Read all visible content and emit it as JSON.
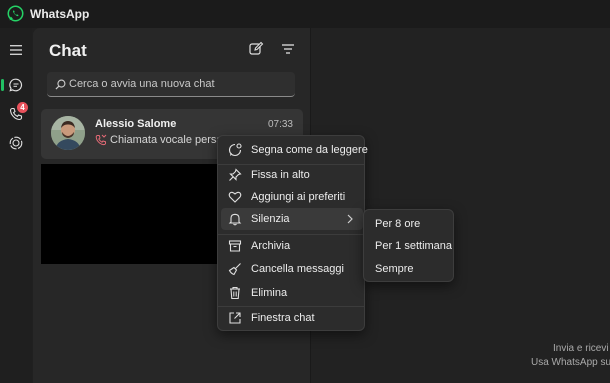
{
  "app": {
    "title": "WhatsApp",
    "accent": "#21c063"
  },
  "rail": {
    "items": [
      {
        "name": "menu",
        "icon": "hamburger-icon"
      },
      {
        "name": "chats",
        "icon": "chat-bubble-icon",
        "active": true
      },
      {
        "name": "calls",
        "icon": "phone-icon",
        "badge": "4"
      },
      {
        "name": "status",
        "icon": "status-icon"
      }
    ]
  },
  "chat_list": {
    "heading": "Chat",
    "search_placeholder": "Cerca o avvia una nuova chat",
    "chats": [
      {
        "name": "Alessio Salome",
        "time": "07:33",
        "preview": "Chiamata vocale persa",
        "preview_icon": "missed-call-icon"
      }
    ]
  },
  "context_menu": {
    "items": [
      {
        "label": "Segna come da leggere",
        "icon": "mark-unread-icon"
      },
      {
        "label": "Fissa in alto",
        "icon": "pin-icon"
      },
      {
        "label": "Aggiungi ai preferiti",
        "icon": "heart-icon"
      },
      {
        "label": "Silenzia",
        "icon": "bell-icon",
        "submenu": true
      },
      {
        "label": "Archivia",
        "icon": "archive-icon"
      },
      {
        "label": "Cancella messaggi",
        "icon": "broom-icon"
      },
      {
        "label": "Elimina",
        "icon": "trash-icon"
      },
      {
        "label": "Finestra chat",
        "icon": "external-window-icon"
      }
    ]
  },
  "mute_submenu": {
    "items": [
      {
        "label": "Per 8 ore"
      },
      {
        "label": "Per 1 settimana"
      },
      {
        "label": "Sempre"
      }
    ]
  },
  "right_pane": {
    "line1": "Invia e ricevi",
    "line2": "Usa WhatsApp su"
  }
}
